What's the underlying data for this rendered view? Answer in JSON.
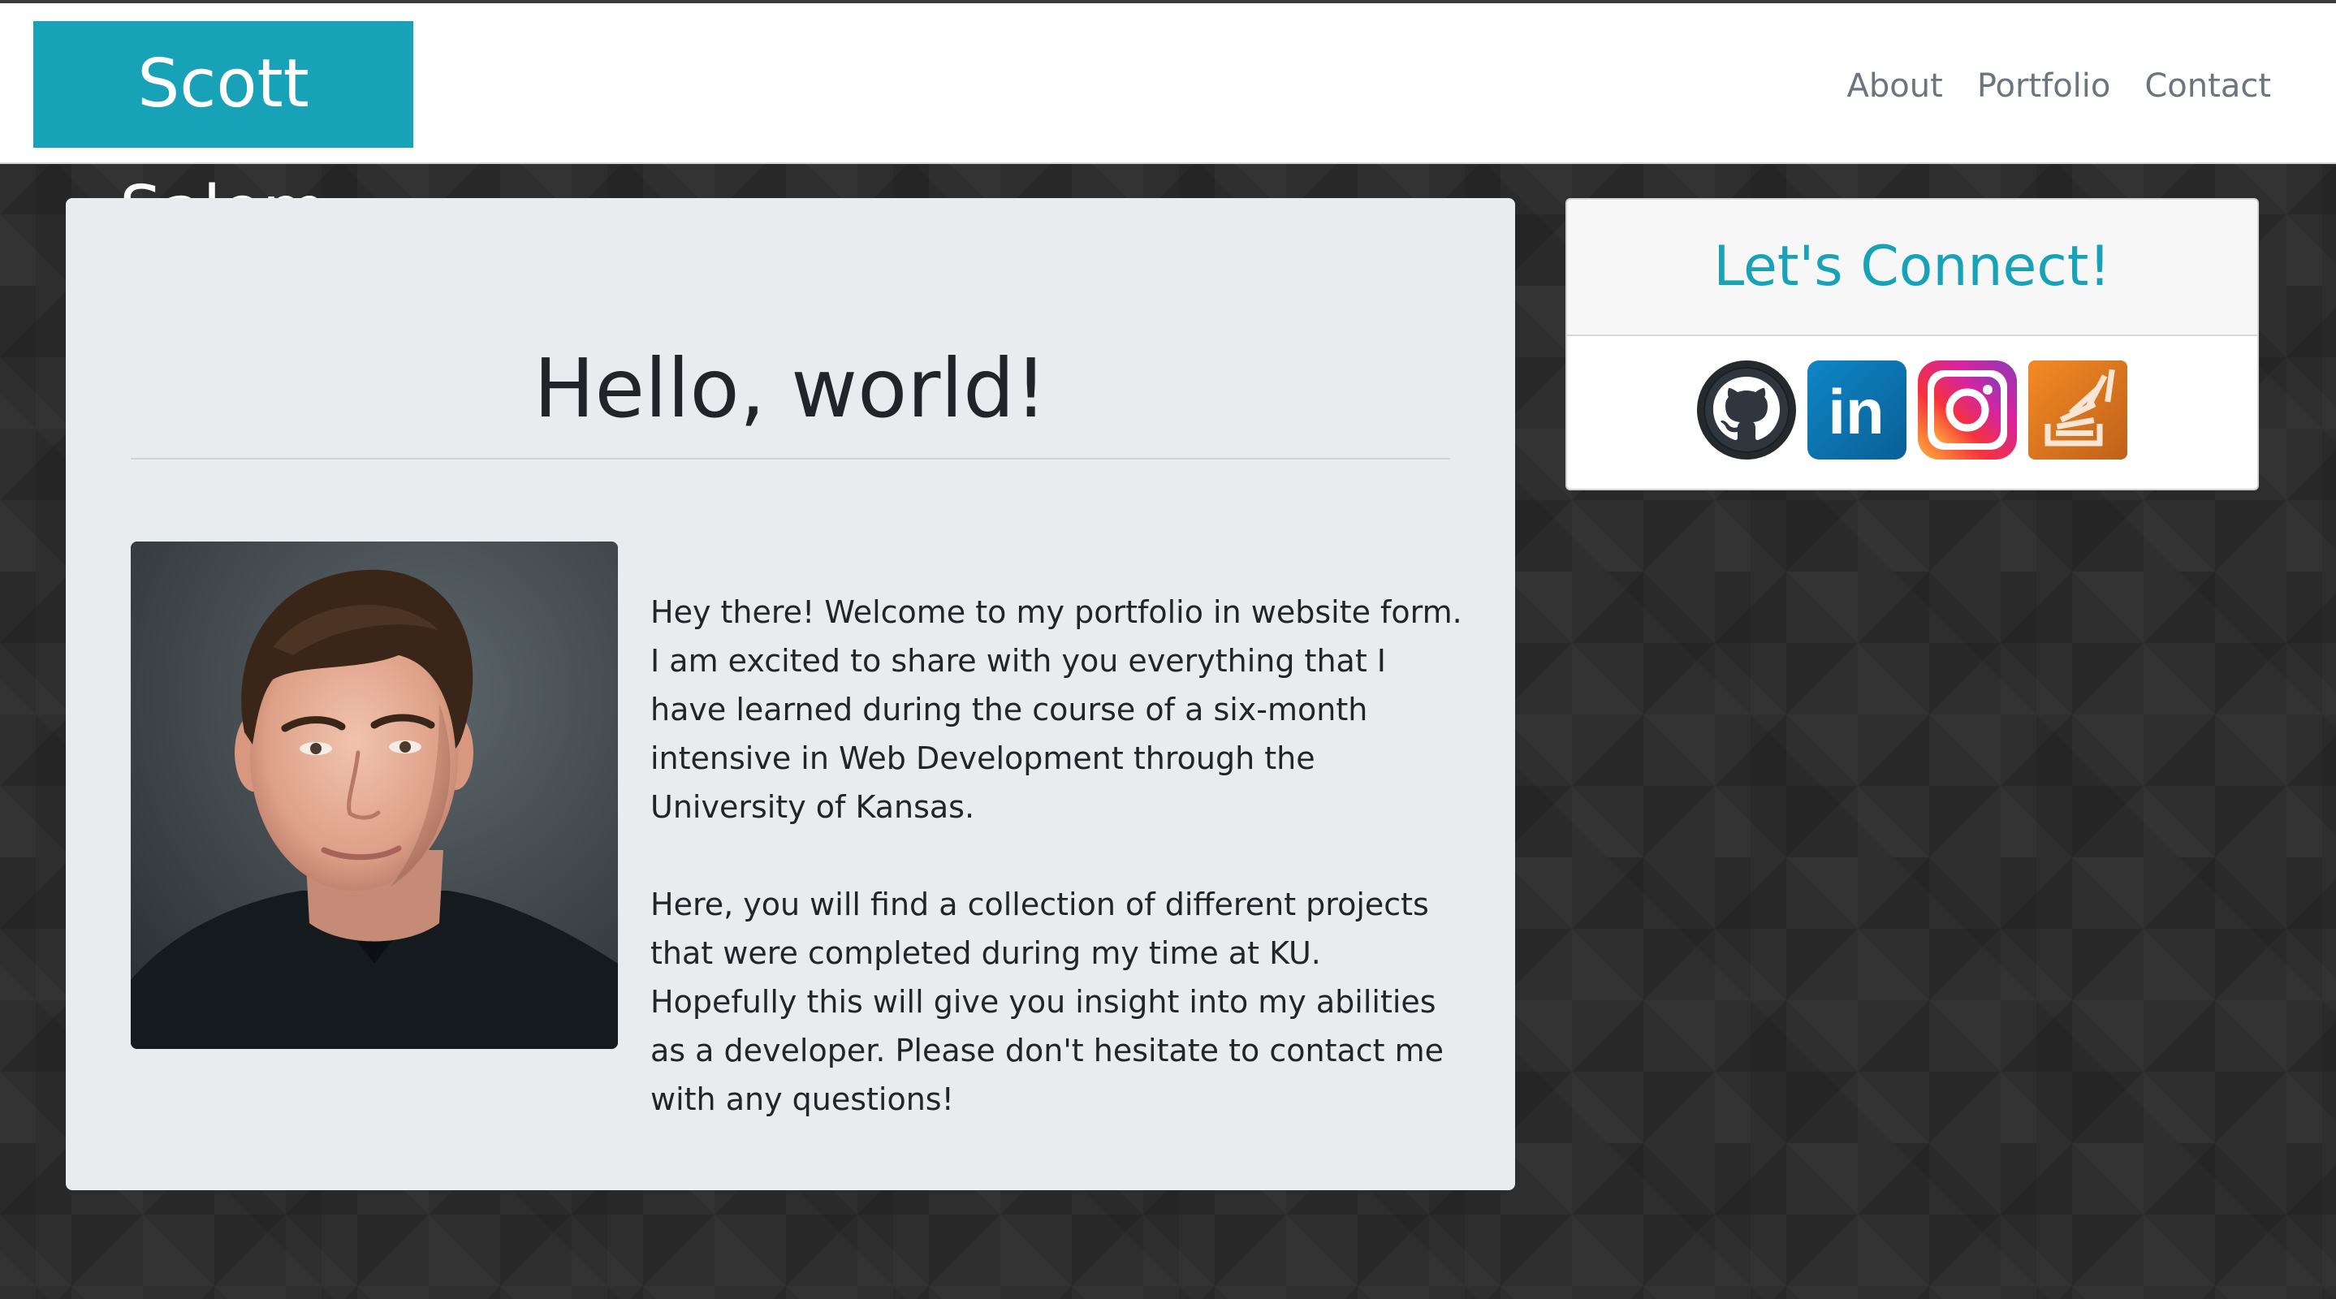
{
  "header": {
    "brand": "Scott Salem",
    "nav": [
      {
        "label": "About"
      },
      {
        "label": "Portfolio"
      },
      {
        "label": "Contact"
      }
    ]
  },
  "main": {
    "heading": "Hello, world!",
    "photo_alt": "Portrait photo of Scott Salem",
    "paragraphs": [
      "Hey there! Welcome to my portfolio in website form. I am excited to share with you everything that I have learned during the course of a six-month intensive in Web Development through the University of Kansas.",
      "Here, you will find a collection of different projects that were completed during my time at KU. Hopefully this will give you insight into my abilities as a developer. Please don't hesitate to contact me with any questions!"
    ]
  },
  "connect": {
    "title": "Let's Connect!",
    "links": [
      {
        "name": "github",
        "icon": "github-icon"
      },
      {
        "name": "linkedin",
        "icon": "linkedin-icon",
        "text": "in"
      },
      {
        "name": "instagram",
        "icon": "instagram-icon"
      },
      {
        "name": "stackoverflow",
        "icon": "stackoverflow-icon"
      }
    ]
  },
  "colors": {
    "brand": "#17a2b8",
    "background": "#2e2e2e",
    "jumbotron": "#e9ecef",
    "nav_text": "#6c757d"
  }
}
